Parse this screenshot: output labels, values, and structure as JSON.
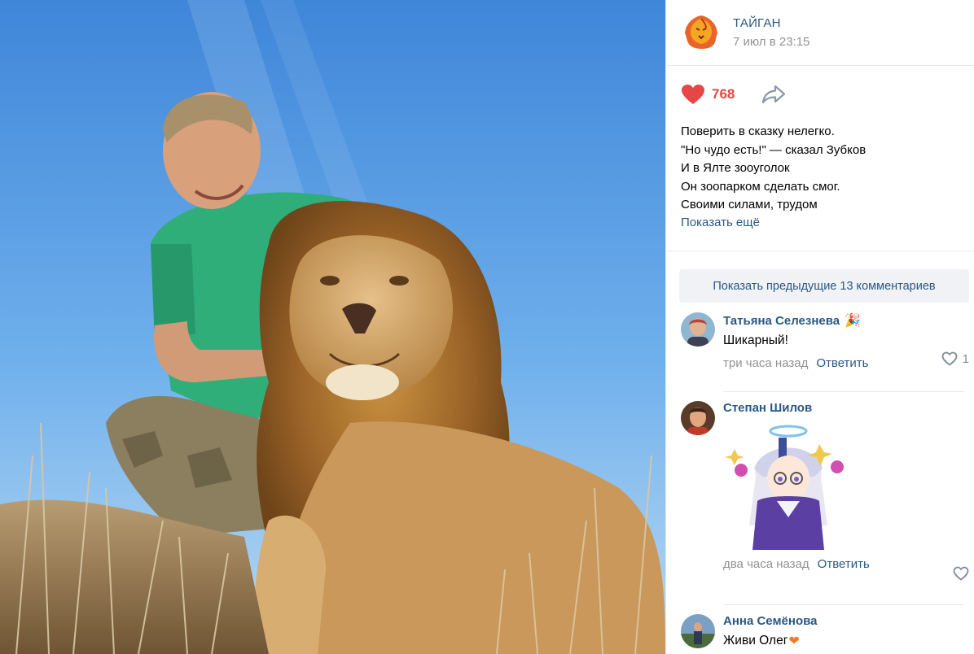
{
  "post": {
    "group_name": "ТАЙГАН",
    "date": "7 июл в 23:15",
    "likes": "768",
    "text_lines": [
      "Поверить в сказку нелегко.",
      "\"Но чудо есть!\" — сказал Зубков",
      "И в Ялте зооуголок",
      "Он зоопарком сделать смог.",
      "Своими силами, трудом"
    ],
    "show_more": "Показать ещё"
  },
  "comments_panel": {
    "show_previous": "Показать предыдущие 13 комментариев",
    "items": [
      {
        "author": "Татьяна Селезнева",
        "text": "Шикарный!",
        "time": "три часа назад",
        "reply": "Ответить",
        "likes": "1"
      },
      {
        "author": "Степан Шилов",
        "text": "",
        "time": "два часа назад",
        "reply": "Ответить",
        "likes": ""
      },
      {
        "author": "Анна Семёнова",
        "text": "Живи Олег",
        "time": "",
        "reply": "",
        "likes": ""
      }
    ]
  },
  "icons": {
    "like": "heart-icon",
    "share": "share-arrow-icon",
    "comment_like": "heart-outline-icon",
    "group_avatar": "lion-logo-icon",
    "sticker": "anime-girl-sticker",
    "emoji_orange_heart": "orange-heart-emoji",
    "emoji_party": "party-emoji"
  },
  "colors": {
    "accent": "#2a5885",
    "like": "#e64646",
    "muted": "#939393",
    "sky": "#5e9ee0"
  }
}
